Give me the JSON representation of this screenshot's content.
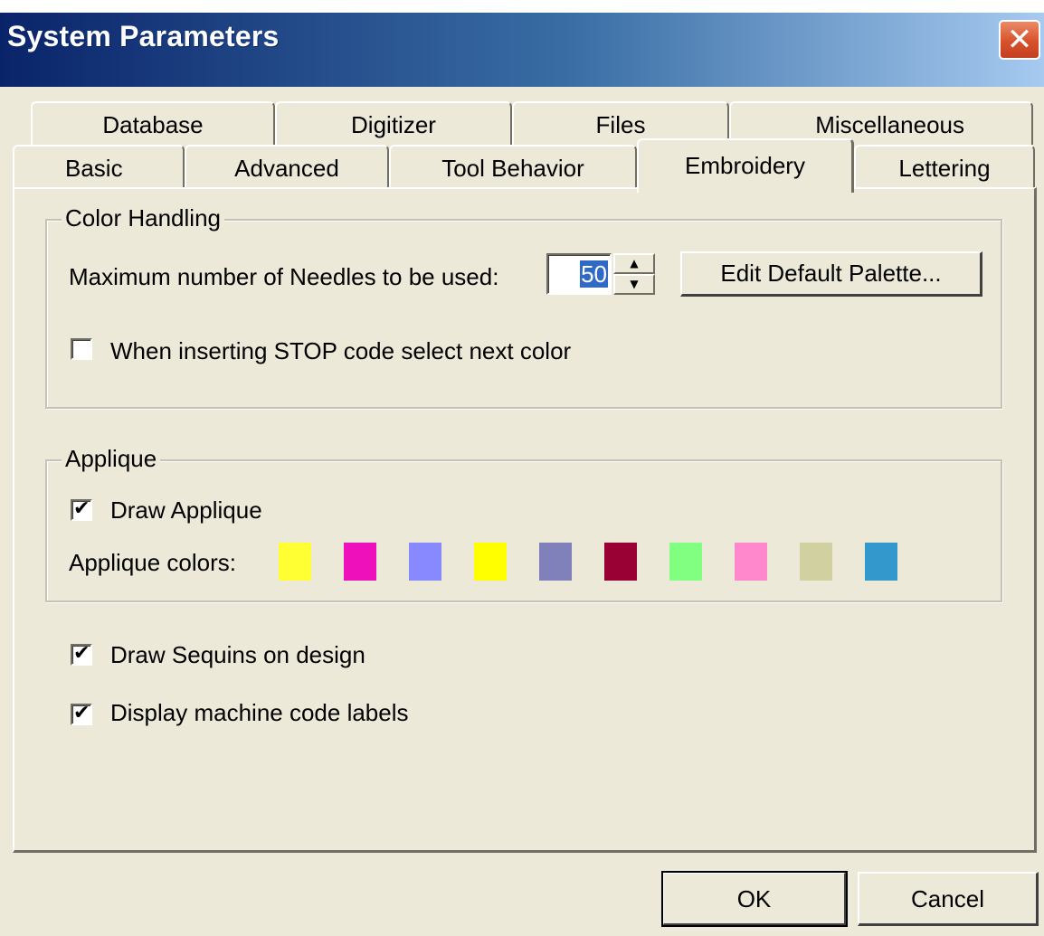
{
  "window": {
    "title": "System Parameters",
    "close_glyph": "✕"
  },
  "tabs": {
    "row1": [
      {
        "label": "Database"
      },
      {
        "label": "Digitizer"
      },
      {
        "label": "Files"
      },
      {
        "label": "Miscellaneous"
      }
    ],
    "row2": [
      {
        "label": "Basic"
      },
      {
        "label": "Advanced"
      },
      {
        "label": "Tool Behavior"
      },
      {
        "label": "Embroidery",
        "active": true
      },
      {
        "label": "Lettering"
      }
    ]
  },
  "color_handling": {
    "title": "Color Handling",
    "max_needles_label": "Maximum number of Needles to be used:",
    "max_needles_value": "50",
    "edit_palette_button": "Edit Default Palette...",
    "stop_code_label": "When inserting STOP code select next color",
    "stop_code_checked": false
  },
  "applique": {
    "title": "Applique",
    "draw_applique_label": "Draw Applique",
    "draw_applique_checked": true,
    "colors_label": "Applique colors:",
    "colors": [
      "#ffff33",
      "#ee11bb",
      "#8888ff",
      "#ffff00",
      "#8080bb",
      "#990033",
      "#80ff80",
      "#ff88cc",
      "#d0d0a0",
      "#3399cc"
    ]
  },
  "options": {
    "draw_sequins_label": "Draw Sequins on design",
    "draw_sequins_checked": true,
    "machine_labels_label": "Display machine code labels",
    "machine_labels_checked": true
  },
  "buttons": {
    "ok": "OK",
    "cancel": "Cancel"
  },
  "glyphs": {
    "check": "✔",
    "up_arrow": "▲",
    "down_arrow": "▼"
  }
}
